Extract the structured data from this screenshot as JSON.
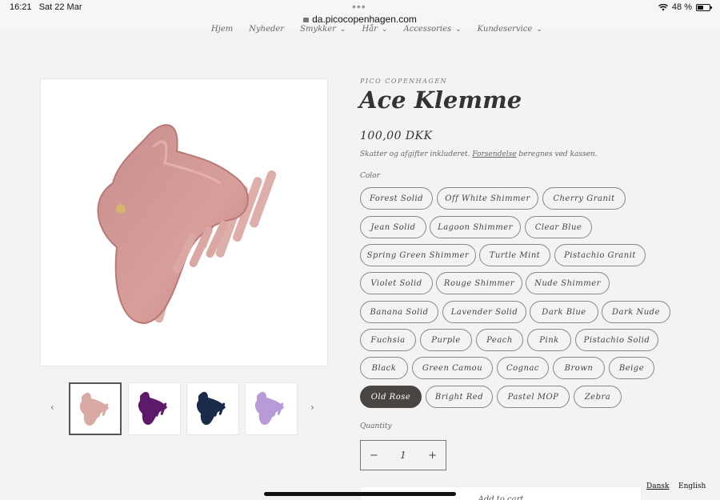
{
  "status": {
    "time": "16:21",
    "date": "Sat 22 Mar",
    "url": "da.picocopenhagen.com",
    "battery": "48 %",
    "battery_level": 0.48
  },
  "nav": [
    {
      "label": "Hjem",
      "chevron": false
    },
    {
      "label": "Nyheder",
      "chevron": false
    },
    {
      "label": "Smykker",
      "chevron": true
    },
    {
      "label": "Hår",
      "chevron": true
    },
    {
      "label": "Accessories",
      "chevron": true
    },
    {
      "label": "Kundeservice",
      "chevron": true
    }
  ],
  "product": {
    "brand": "PICO COPENHAGEN",
    "title": "Ace Klemme",
    "price": "100,00 DKK",
    "tax_prefix": "Skatter og afgifter inkluderet.",
    "tax_link": "Forsendelse",
    "tax_suffix": "beregnes ved kassen.",
    "color_label": "Color",
    "selected_color": "Old Rose",
    "colors": [
      "Forest Solid",
      "Off White Shimmer",
      "Cherry Granit",
      "Jean Solid",
      "Lagoon Shimmer",
      "Clear Blue",
      "Spring Green Shimmer",
      "Turtle Mint",
      "Pistachio Granit",
      "Violet Solid",
      "Rouge Shimmer",
      "Nude Shimmer",
      "Banana Solid",
      "Lavender Solid",
      "Dark Blue",
      "Dark Nude",
      "Fuchsia",
      "Purple",
      "Peach",
      "Pink",
      "Pistachio Solid",
      "Black",
      "Green Camou",
      "Cognac",
      "Brown",
      "Beige",
      "Old Rose",
      "Bright Red",
      "Pastel MOP",
      "Zebra"
    ],
    "quantity_label": "Quantity",
    "quantity": "1",
    "add_to_cart": "Add to cart"
  },
  "thumbnails": [
    {
      "name": "old-rose",
      "color": "#d9a9a3"
    },
    {
      "name": "purple",
      "color": "#5d1a6b"
    },
    {
      "name": "dark-blue",
      "color": "#1a2a4a"
    },
    {
      "name": "lavender",
      "color": "#b89ad9"
    }
  ],
  "languages": {
    "dansk": "Dansk",
    "english": "English"
  },
  "colors": {
    "accent": "#4a4542",
    "product": "#c98f8f"
  }
}
